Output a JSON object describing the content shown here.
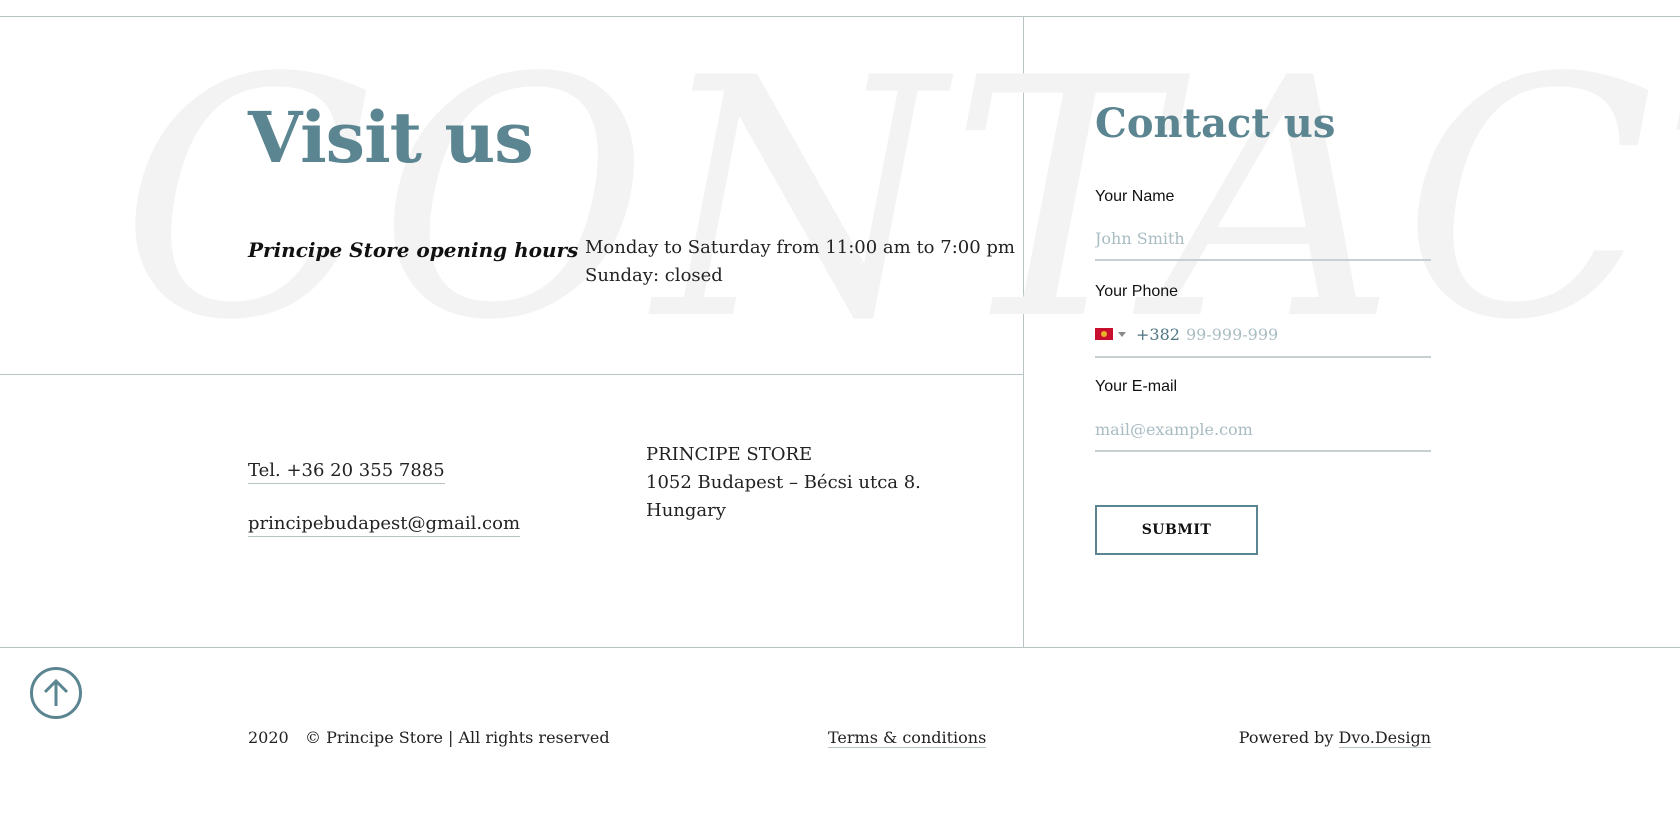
{
  "visit": {
    "background_word": "CONTACTS",
    "title": "Visit us",
    "hours_label": "Principe Store opening hours",
    "hours_lines": [
      "Monday to Saturday from 11:00 am to 7:00 pm",
      "Sunday: closed"
    ]
  },
  "contacts": {
    "tel": "Tel. +36 20 355 7885",
    "email": "principebudapest@gmail.com",
    "address_lines": [
      "PRINCIPE STORE",
      "1052 Budapest – Bécsi utca 8.",
      "Hungary"
    ]
  },
  "form": {
    "title": "Contact us",
    "name_label": "Your Name",
    "name_placeholder": "John Smith",
    "phone_label": "Your Phone",
    "phone_dial_code": "+382",
    "phone_placeholder": "99-999-999",
    "email_label": "Your E-mail",
    "email_placeholder": "mail@example.com",
    "submit_label": "SUBMIT"
  },
  "footer": {
    "year": "2020",
    "copyright": "© Principe Store | All rights reserved",
    "terms": "Terms & conditions",
    "powered_prefix": "Powered by",
    "powered_link": "Dvo.Design"
  },
  "icons": {
    "scroll_top": "arrow-up-circle-icon",
    "flag": "montenegro-flag-icon",
    "dropdown": "caret-down-icon"
  },
  "colors": {
    "accent": "#5b8591",
    "rule": "#b9c3c6",
    "placeholder": "#a8bcc2",
    "watermark": "#f3f3f3"
  }
}
